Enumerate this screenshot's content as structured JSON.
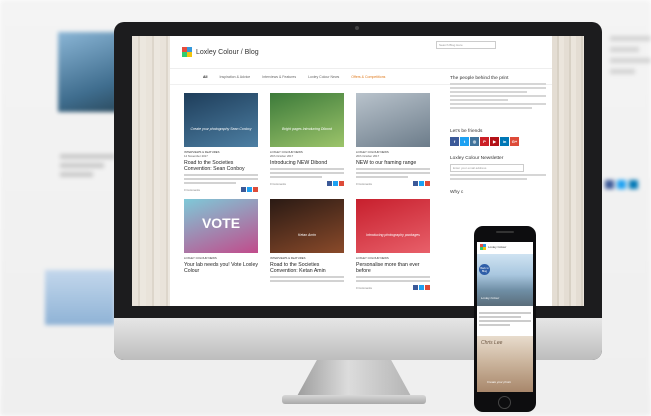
{
  "site": {
    "logo_text": "Loxley Colour / Blog",
    "search_placeholder": "Search Blog Here",
    "nav": [
      "All",
      "Inspiration & Advice",
      "Interviews & Features",
      "Loxley Colour News",
      "Offers & Competitions"
    ]
  },
  "posts": [
    {
      "category": "INTERVIEWS & FEATURES",
      "date": "14 November 2017",
      "title": "Road to the Societies Convention: Sean Conboy",
      "comments": "0 Comments",
      "image_caption": "Create your photography Sean Conboy",
      "image_colors": [
        "#1e3d5a",
        "#4d7fa3"
      ]
    },
    {
      "category": "LOXLEY COLOUR NEWS",
      "date": "20th October 2017",
      "title": "Introducing NEW Dibond",
      "comments": "0 Comments",
      "image_caption": "Bright pages Introducing Dibond",
      "image_colors": [
        "#3c7a3a",
        "#9cc46a"
      ]
    },
    {
      "category": "LOXLEY COLOUR NEWS",
      "date": "20th October 2017",
      "title": "NEW to our framing range",
      "comments": "0 Comments",
      "image_caption": "",
      "image_colors": [
        "#b9c3cc",
        "#6c7c8a"
      ]
    },
    {
      "category": "LOXLEY COLOUR NEWS",
      "date": "10th October 2017",
      "title": "Your lab needs you! Vote Loxley Colour",
      "comments": "",
      "image_caption": "VOTE",
      "image_colors": [
        "#7ec9d8",
        "#c14b8b"
      ]
    },
    {
      "category": "INTERVIEWS & FEATURES",
      "date": "26th October 2017",
      "title": "Road to the Societies Convention: Ketan Amin",
      "comments": "",
      "image_caption": "Ketan Amin",
      "image_colors": [
        "#2a1a14",
        "#8a4a2a"
      ]
    },
    {
      "category": "LOXLEY COLOUR NEWS",
      "date": "26th October 2017",
      "title": "Personalise more than ever before",
      "comments": "0 Comments",
      "image_caption": "Introducing photography packages",
      "image_colors": [
        "#c71f2d",
        "#e8606a"
      ]
    }
  ],
  "sidebar": {
    "people_title": "The people behind the print",
    "friends_title": "Let's be friends",
    "social_icons": [
      {
        "name": "facebook",
        "color": "#3b5998",
        "glyph": "f"
      },
      {
        "name": "twitter",
        "color": "#1da1f2",
        "glyph": "t"
      },
      {
        "name": "instagram",
        "color": "#3f729b",
        "glyph": "◎"
      },
      {
        "name": "pinterest",
        "color": "#cb2027",
        "glyph": "P"
      },
      {
        "name": "youtube",
        "color": "#b31217",
        "glyph": "▶"
      },
      {
        "name": "linkedin",
        "color": "#0077b5",
        "glyph": "in"
      },
      {
        "name": "google-plus",
        "color": "#dd4b39",
        "glyph": "G+"
      }
    ],
    "newsletter_title": "Loxley Colour Newsletter",
    "newsletter_placeholder": "Enter your email address",
    "why_title": "Why c"
  },
  "phone": {
    "logo_text": "Loxley Colour",
    "badge_text": "Back to Blog",
    "hero_caption": "Loxley Colour",
    "photo_script": "Chris Lee",
    "photo_caption": "Create your photo"
  },
  "colors": {
    "accent_orange": "#e07b1e",
    "brand_blue": "#2a5aa3"
  }
}
